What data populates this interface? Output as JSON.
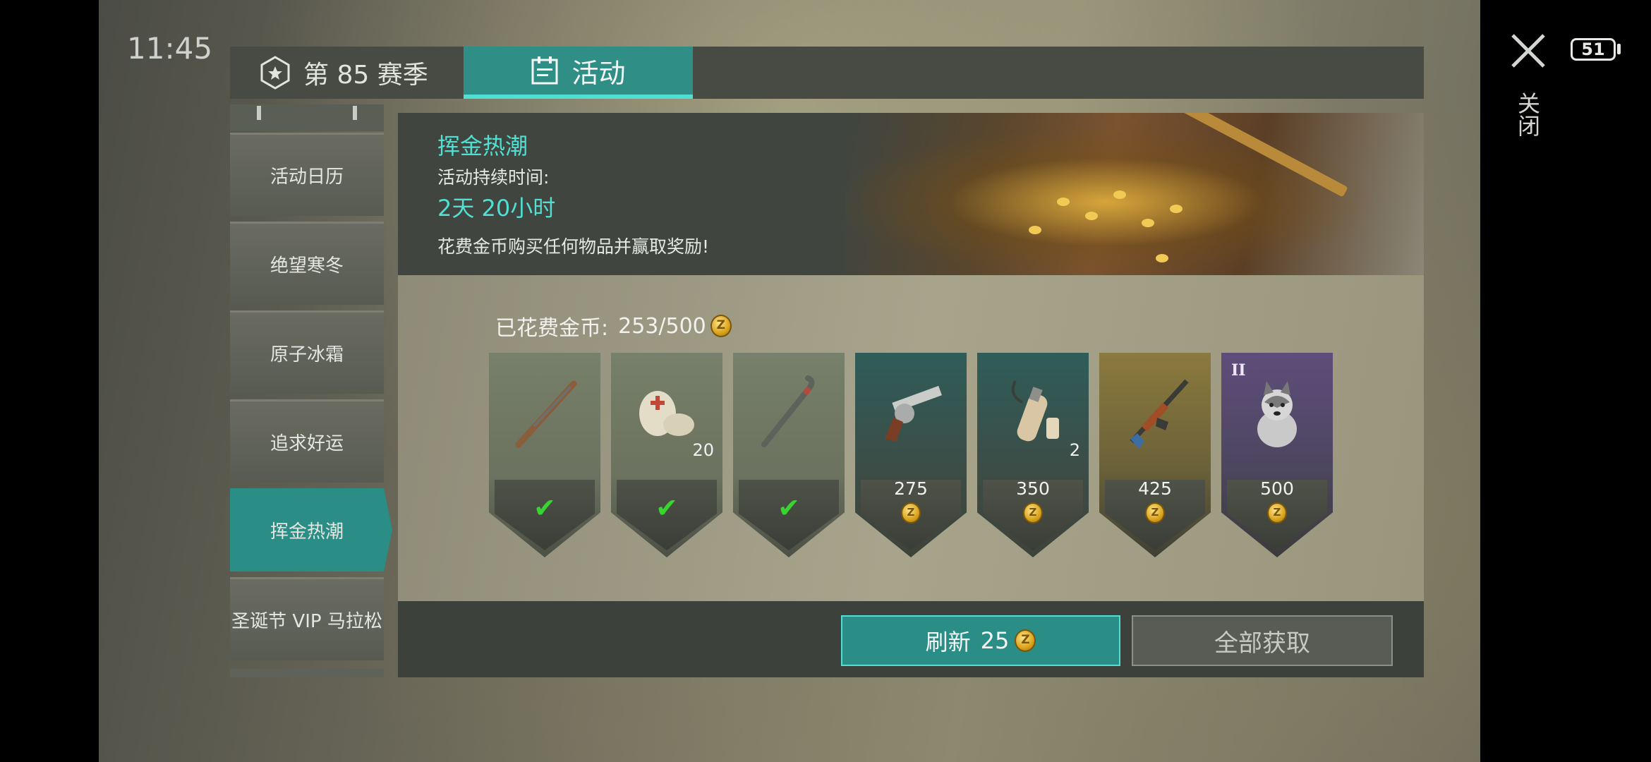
{
  "status_bar": {
    "time": "11:45",
    "battery": "51"
  },
  "header": {
    "tabs": [
      {
        "label": "第 85 赛季",
        "active": false,
        "icon": "season-badge-icon"
      },
      {
        "label": "活动",
        "active": true,
        "icon": "calendar-icon"
      }
    ]
  },
  "sidebar": {
    "items": [
      {
        "label": "活动日历",
        "active": false
      },
      {
        "label": "绝望寒冬",
        "active": false
      },
      {
        "label": "原子冰霜",
        "active": false
      },
      {
        "label": "追求好运",
        "active": false
      },
      {
        "label": "挥金热潮",
        "active": true
      },
      {
        "label": "圣诞节 VIP 马拉松",
        "active": false
      }
    ]
  },
  "event": {
    "title": "挥金热潮",
    "duration_label": "活动持续时间:",
    "duration": "2天 20小时",
    "description": "花费金币购买任何物品并赢取奖励!",
    "spent_label": "已花费金币:",
    "spent_value": "253/500",
    "rewards": [
      {
        "item": "rifle",
        "status": "claimed",
        "quantity": null,
        "price": null
      },
      {
        "item": "bandage",
        "status": "claimed",
        "quantity": "20",
        "price": null
      },
      {
        "item": "crowbar",
        "status": "claimed",
        "quantity": null,
        "price": null
      },
      {
        "item": "revolver",
        "status": "locked",
        "quantity": null,
        "price": "275"
      },
      {
        "item": "bottle-bag",
        "status": "locked",
        "quantity": "2",
        "price": "350"
      },
      {
        "item": "ak-rifle",
        "status": "locked",
        "quantity": null,
        "price": "425"
      },
      {
        "item": "husky-pet",
        "status": "locked",
        "quantity": null,
        "price": "500",
        "tier": "II"
      }
    ]
  },
  "footer": {
    "refresh_label": "刷新",
    "refresh_cost": "25",
    "claim_all_label": "全部获取"
  },
  "close_label": "关闭",
  "colors": {
    "accent": "#2a8d86",
    "accent_text": "#4fe0d3",
    "check": "#38d42f"
  }
}
